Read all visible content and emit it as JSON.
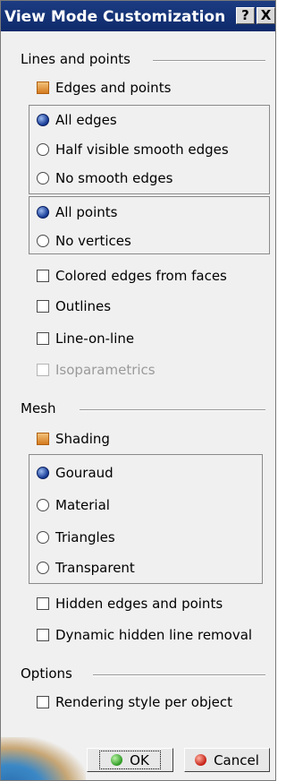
{
  "window": {
    "title": "View Mode Customization",
    "help_label": "?",
    "close_label": "X"
  },
  "lines_points": {
    "heading": "Lines and points",
    "edges_points": {
      "label": "Edges and points",
      "checked": true
    },
    "edges_group": [
      {
        "label": "All edges",
        "selected": true
      },
      {
        "label": "Half visible smooth edges",
        "selected": false
      },
      {
        "label": "No smooth edges",
        "selected": false
      }
    ],
    "points_group": [
      {
        "label": "All points",
        "selected": true
      },
      {
        "label": "No vertices",
        "selected": false
      }
    ],
    "colored_edges": {
      "label": "Colored edges from faces",
      "checked": false
    },
    "outlines": {
      "label": "Outlines",
      "checked": false
    },
    "line_on_line": {
      "label": "Line-on-line",
      "checked": false
    },
    "isoparametrics": {
      "label": "Isoparametrics",
      "checked": false,
      "enabled": false
    }
  },
  "mesh": {
    "heading": "Mesh",
    "shading": {
      "label": "Shading",
      "checked": true
    },
    "shading_group": [
      {
        "label": "Gouraud",
        "selected": true
      },
      {
        "label": "Material",
        "selected": false
      },
      {
        "label": "Triangles",
        "selected": false
      },
      {
        "label": "Transparent",
        "selected": false
      }
    ],
    "hidden_edges": {
      "label": "Hidden edges and points",
      "checked": false
    },
    "dynamic_hlr": {
      "label": "Dynamic hidden line removal",
      "checked": false
    }
  },
  "options": {
    "heading": "Options",
    "rendering_style": {
      "label": "Rendering style per object",
      "checked": false
    }
  },
  "buttons": {
    "ok_label": "OK",
    "cancel_label": "Cancel"
  },
  "colors": {
    "titlebar": "#1c3c82",
    "checked_box": "#d47a1e",
    "radio_selected": "#1a3f9a",
    "ok_icon": "#2c9a22",
    "cancel_icon": "#c41c12"
  }
}
